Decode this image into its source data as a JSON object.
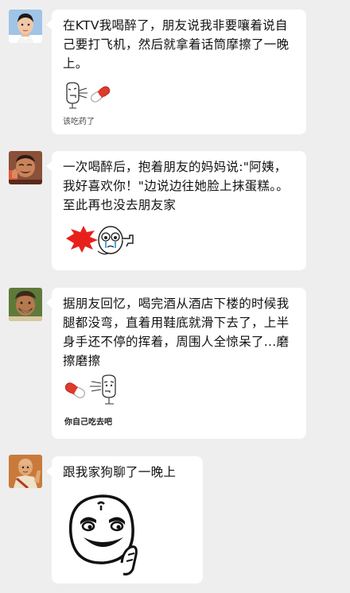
{
  "messages": [
    {
      "avatar_icon": "boy-avatar-icon",
      "text": "在KTV我喝醉了，朋友说我非要嚷着说自己要打飞机，然后就拿着话筒摩擦了一晚上。",
      "sticker_icon": "face-with-pill-sticker-icon",
      "sticker_caption": "该吃药了"
    },
    {
      "avatar_icon": "laughing-man-avatar-icon",
      "text": "一次喝醉后，抱着朋友的妈妈说:\"阿姨，我好喜欢你！\"边说边往她脸上抹蛋糕。。至此再也没去朋友家",
      "sticker_icon": "crying-face-shot-sticker-icon",
      "sticker_caption": ""
    },
    {
      "avatar_icon": "grinning-man-avatar-icon",
      "text": "据朋友回忆，喝完酒从酒店下楼的时候我腿都没弯，直着用鞋底就滑下去了，上半身手还不停的挥着，周围人全惊呆了...磨擦磨擦",
      "sticker_icon": "pill-with-face-sticker-icon",
      "sticker_caption": "你自己吃去吧"
    },
    {
      "avatar_icon": "monk-avatar-icon",
      "text": "跟我家狗聊了一晚上",
      "sticker_icon": "grinning-face-sticker-icon",
      "sticker_caption": ""
    }
  ]
}
